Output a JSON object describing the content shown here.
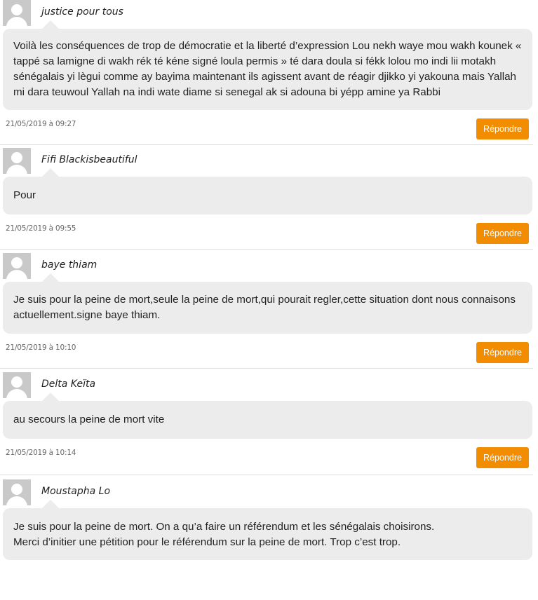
{
  "comments": [
    {
      "author": "justice pour tous",
      "text": "Voilà les conséquences de trop de démocratie et la liberté d’expression Lou nekh waye mou wakh kounek « tappé sa lamigne di wakh rék té kéne signé loula permis » té dara doula si fékk lolou mo indi lii motakh sénégalais yi lègui comme ay bayima maintenant ils agissent avant de réagir djikko yi yakouna mais Yallah mi dara teuwoul Yallah na indi wate diame si senegal ak si adouna bi yépp amine ya Rabbi",
      "date": "21/05/2019 à 09:27",
      "reply_label": "Répondre"
    },
    {
      "author": "Fifi Blackisbeautiful",
      "text": "Pour",
      "date": "21/05/2019 à 09:55",
      "reply_label": "Répondre"
    },
    {
      "author": "baye thiam",
      "text": "Je suis pour la peine de mort,seule la peine de mort,qui pourait regler,cette situation dont nous connaisons actuellement.signe baye thiam.",
      "date": "21/05/2019 à 10:10",
      "reply_label": "Répondre"
    },
    {
      "author": "Delta Keïta",
      "text": "au secours la peine de mort vite",
      "date": "21/05/2019 à 10:14",
      "reply_label": "Répondre"
    },
    {
      "author": "Moustapha Lo",
      "text_lines": [
        "Je suis pour la peine de mort. On a qu’a faire un référendum et les sénégalais choisirons.",
        "Merci d’initier une pétition pour le référendum sur la peine de mort. Trop c’est trop."
      ]
    }
  ]
}
